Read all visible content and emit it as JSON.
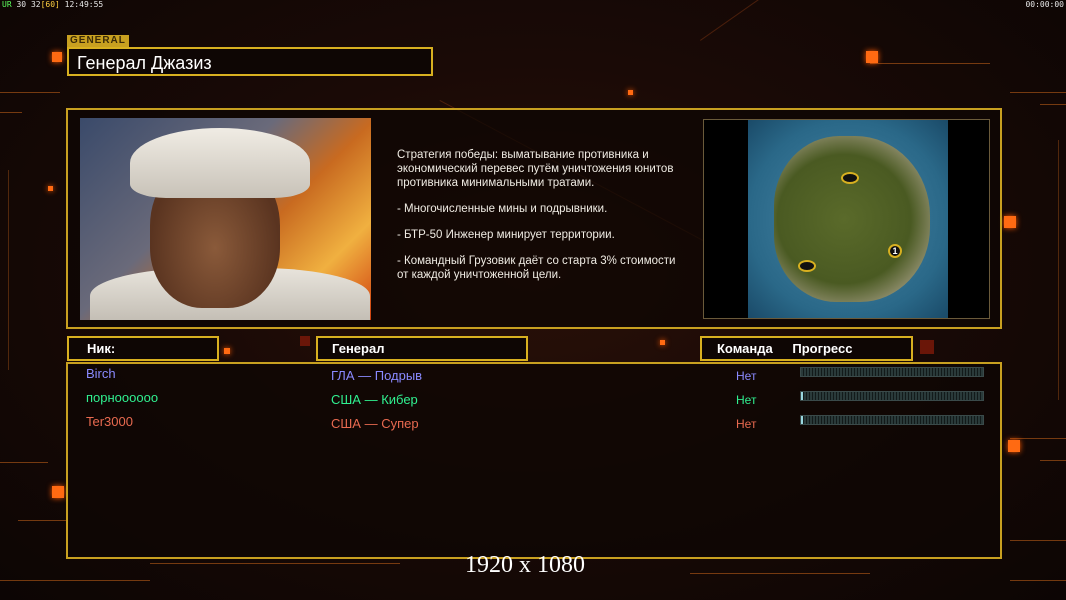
{
  "hud": {
    "left_ur": "UR",
    "left_a": "30",
    "left_b": "32",
    "left_c": "[60]",
    "left_time": "12:49:55",
    "right_time": "00:00:00"
  },
  "general": {
    "tag": "GENERAL",
    "name": "Генерал Джазиз"
  },
  "description": {
    "strategy": "Стратегия победы: выматывание противника и экономический перевес путём уничтожения юнитов противника минимальными тратами.",
    "bullet1": "- Многочисленные мины и подрывники.",
    "bullet2": "- БТР-50 Инженер минирует территории.",
    "bullet3": "- Командный Грузовик даёт со старта 3% стоимости от каждой уничтоженной цели."
  },
  "map": {
    "start_marker": "1"
  },
  "table": {
    "headers": {
      "nick": "Ник:",
      "general": "Генерал",
      "team": "Команда",
      "progress": "Прогресс"
    },
    "rows": [
      {
        "nick": "Birch",
        "general": "ГЛА — Подрыв",
        "team": "Нет",
        "color": "#8a8aff",
        "progress": 0.0
      },
      {
        "nick": "порноооооо",
        "general": "США — Кибер",
        "team": "Нет",
        "color": "#30f090",
        "progress": 0.01
      },
      {
        "nick": "Ter3000",
        "general": "США — Супер",
        "team": "Нет",
        "color": "#e86a50",
        "progress": 0.01
      }
    ]
  },
  "resolution": "1920 x 1080"
}
